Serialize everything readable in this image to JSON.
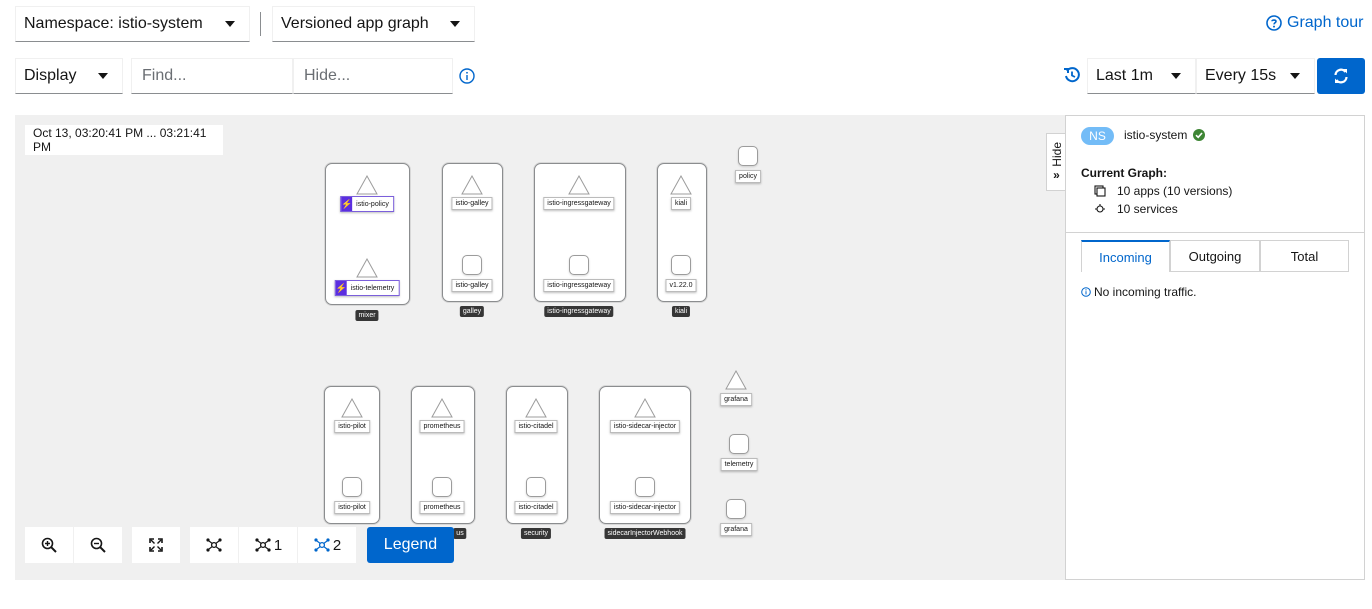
{
  "toolbar": {
    "namespace": "Namespace: istio-system",
    "graph_type": "Versioned app graph",
    "graph_tour": "Graph tour",
    "display": "Display",
    "find_placeholder": "Find...",
    "hide_placeholder": "Hide...",
    "duration": "Last 1m",
    "refresh": "Every 15s"
  },
  "graph": {
    "timestamp": "Oct 13, 03:20:41 PM ... 03:21:41 PM",
    "nodes": {
      "istio_policy": "istio-policy",
      "istio_telemetry": "istio-telemetry",
      "mixer": "mixer",
      "galley_top": "istio-galley",
      "galley_bottom": "istio-galley",
      "galley_group": "galley",
      "ingress_top": "istio-ingressgateway",
      "ingress_bottom": "istio-ingressgateway",
      "ingress_group": "istio-ingressgateway",
      "kiali_top": "kiali",
      "kiali_bottom": "v1.22.0",
      "kiali_group": "kiali",
      "policy": "policy",
      "pilot_top": "istio-pilot",
      "pilot_bottom": "istio-pilot",
      "prometheus_top": "prometheus",
      "prometheus_bottom": "prometheus",
      "prometheus_group": "us",
      "citadel_top": "istio-citadel",
      "citadel_bottom": "istio-citadel",
      "security_group": "security",
      "injector_top": "istio-sidecar-injector",
      "injector_bottom": "istio-sidecar-injector",
      "injector_group": "sidecarInjectorWebhook",
      "grafana_app": "grafana",
      "telemetry": "telemetry",
      "grafana_svc": "grafana"
    },
    "controls": {
      "layout1": "1",
      "layout2": "2",
      "legend": "Legend"
    }
  },
  "side_panel": {
    "hide": "Hide",
    "ns_badge": "NS",
    "namespace": "istio-system",
    "current_graph": "Current Graph:",
    "apps": "10 apps (10 versions)",
    "services": "10 services",
    "tabs": [
      "Incoming",
      "Outgoing",
      "Total"
    ],
    "active_tab": "Incoming",
    "no_traffic": "No incoming traffic."
  },
  "colors": {
    "primary": "#0066cc",
    "badge_bg": "#73bcf7",
    "healthy": "#3e8635",
    "version_icon": "#5b2ee0"
  }
}
